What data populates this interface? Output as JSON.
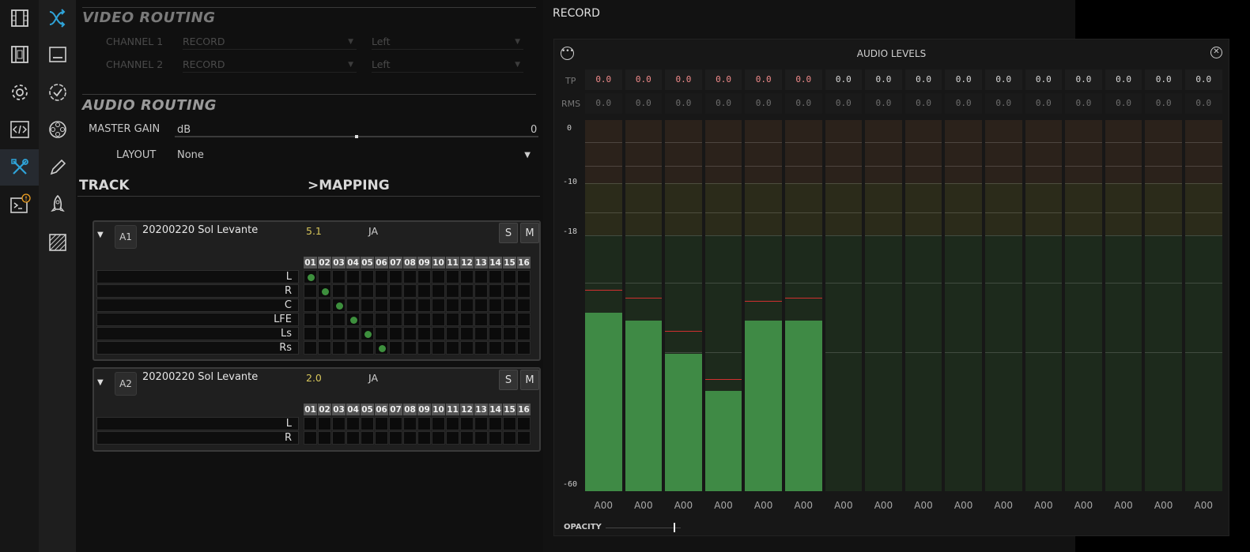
{
  "sidebar_primary": [
    {
      "name": "film-icon"
    },
    {
      "name": "film-strip-icon"
    },
    {
      "name": "gear-icon"
    },
    {
      "name": "code-icon"
    },
    {
      "name": "tools-icon",
      "active": true
    },
    {
      "name": "terminal-alert-icon"
    }
  ],
  "sidebar_secondary": [
    {
      "name": "routing-icon"
    },
    {
      "name": "subtitle-icon"
    },
    {
      "name": "badge-check-icon"
    },
    {
      "name": "film-reel-icon"
    },
    {
      "name": "pen-icon"
    },
    {
      "name": "rocket-icon"
    },
    {
      "name": "hatch-icon"
    }
  ],
  "video_routing": {
    "title": "VIDEO ROUTING",
    "channels": [
      {
        "label": "CHANNEL 1",
        "source": "RECORD",
        "side": "Left"
      },
      {
        "label": "CHANNEL 2",
        "source": "RECORD",
        "side": "Left"
      }
    ]
  },
  "audio_routing": {
    "title": "AUDIO ROUTING",
    "master_gain_label": "MASTER GAIN",
    "master_gain_unit": "dB",
    "master_gain_value": "0",
    "layout_label": "LAYOUT",
    "layout_value": "None"
  },
  "table_header": {
    "track": "TRACK",
    "mapping": ">MAPPING"
  },
  "tracks": [
    {
      "badge": "A1",
      "name": "20200220 Sol Levante",
      "format": "5.1",
      "lang": "JA",
      "solo": "S",
      "mute": "M",
      "columns": [
        "01",
        "02",
        "03",
        "04",
        "05",
        "06",
        "07",
        "08",
        "09",
        "10",
        "11",
        "12",
        "13",
        "14",
        "15",
        "16"
      ],
      "channels": [
        "L",
        "R",
        "C",
        "LFE",
        "Ls",
        "Rs"
      ],
      "mapped": [
        1,
        2,
        3,
        4,
        5,
        6
      ]
    },
    {
      "badge": "A2",
      "name": "20200220 Sol Levante",
      "format": "2.0",
      "lang": "JA",
      "solo": "S",
      "mute": "M",
      "columns": [
        "01",
        "02",
        "03",
        "04",
        "05",
        "06",
        "07",
        "08",
        "09",
        "10",
        "11",
        "12",
        "13",
        "14",
        "15",
        "16"
      ],
      "channels": [
        "L",
        "R"
      ],
      "mapped": []
    }
  ],
  "record": {
    "title": "RECORD"
  },
  "audio_levels": {
    "title": "AUDIO LEVELS",
    "tp_label": "TP",
    "rms_label": "RMS",
    "scale_labels": [
      "0",
      "-10",
      "-18",
      "-60"
    ],
    "opacity_label": "OPACITY",
    "opacity_value": 0.9,
    "meters": [
      {
        "tp": "0.0",
        "rms": "0.0",
        "label": "A00",
        "level": 0.48,
        "peak": 0.54,
        "hot": true
      },
      {
        "tp": "0.0",
        "rms": "0.0",
        "label": "A00",
        "level": 0.46,
        "peak": 0.52,
        "hot": true
      },
      {
        "tp": "0.0",
        "rms": "0.0",
        "label": "A00",
        "level": 0.37,
        "peak": 0.43,
        "hot": true
      },
      {
        "tp": "0.0",
        "rms": "0.0",
        "label": "A00",
        "level": 0.27,
        "peak": 0.3,
        "hot": true
      },
      {
        "tp": "0.0",
        "rms": "0.0",
        "label": "A00",
        "level": 0.46,
        "peak": 0.51,
        "hot": true
      },
      {
        "tp": "0.0",
        "rms": "0.0",
        "label": "A00",
        "level": 0.46,
        "peak": 0.52,
        "hot": true
      },
      {
        "tp": "0.0",
        "rms": "0.0",
        "label": "A00",
        "level": 0,
        "peak": 0,
        "hot": false
      },
      {
        "tp": "0.0",
        "rms": "0.0",
        "label": "A00",
        "level": 0,
        "peak": 0,
        "hot": false
      },
      {
        "tp": "0.0",
        "rms": "0.0",
        "label": "A00",
        "level": 0,
        "peak": 0,
        "hot": false
      },
      {
        "tp": "0.0",
        "rms": "0.0",
        "label": "A00",
        "level": 0,
        "peak": 0,
        "hot": false
      },
      {
        "tp": "0.0",
        "rms": "0.0",
        "label": "A00",
        "level": 0,
        "peak": 0,
        "hot": false
      },
      {
        "tp": "0.0",
        "rms": "0.0",
        "label": "A00",
        "level": 0,
        "peak": 0,
        "hot": false
      },
      {
        "tp": "0.0",
        "rms": "0.0",
        "label": "A00",
        "level": 0,
        "peak": 0,
        "hot": false
      },
      {
        "tp": "0.0",
        "rms": "0.0",
        "label": "A00",
        "level": 0,
        "peak": 0,
        "hot": false
      },
      {
        "tp": "0.0",
        "rms": "0.0",
        "label": "A00",
        "level": 0,
        "peak": 0,
        "hot": false
      },
      {
        "tp": "0.0",
        "rms": "0.0",
        "label": "A00",
        "level": 0,
        "peak": 0,
        "hot": false
      }
    ]
  },
  "colors": {
    "accent": "#2fa4d9",
    "meter_green": "#3f8a45",
    "peak_red": "#d03030",
    "hot_text": "#f08a8a",
    "gain_text": "#d6c55a"
  }
}
